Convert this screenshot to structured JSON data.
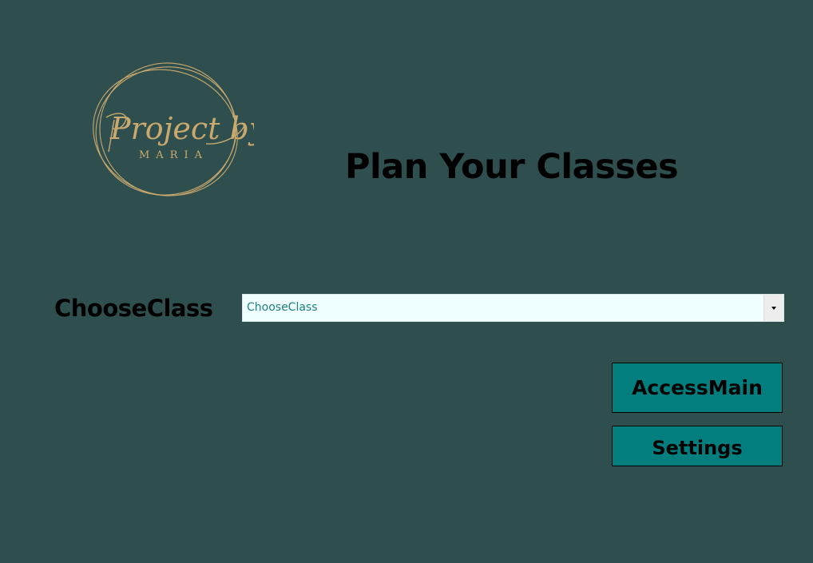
{
  "page": {
    "title": "Plan Your Classes"
  },
  "logo": {
    "script_text": "Project by",
    "sub_text": "MARIA",
    "color": "#c9a96e"
  },
  "form": {
    "choose_class_label": "ChooseClass",
    "choose_class_value": "ChooseClass",
    "dropdown_icon": "chevron-down-icon"
  },
  "buttons": {
    "access_main": "AccessMain",
    "settings": "Settings"
  },
  "colors": {
    "background": "#2f4f4e",
    "button": "#017e7d",
    "combo_background": "#f0ffff",
    "combo_text": "#1f7f80"
  }
}
